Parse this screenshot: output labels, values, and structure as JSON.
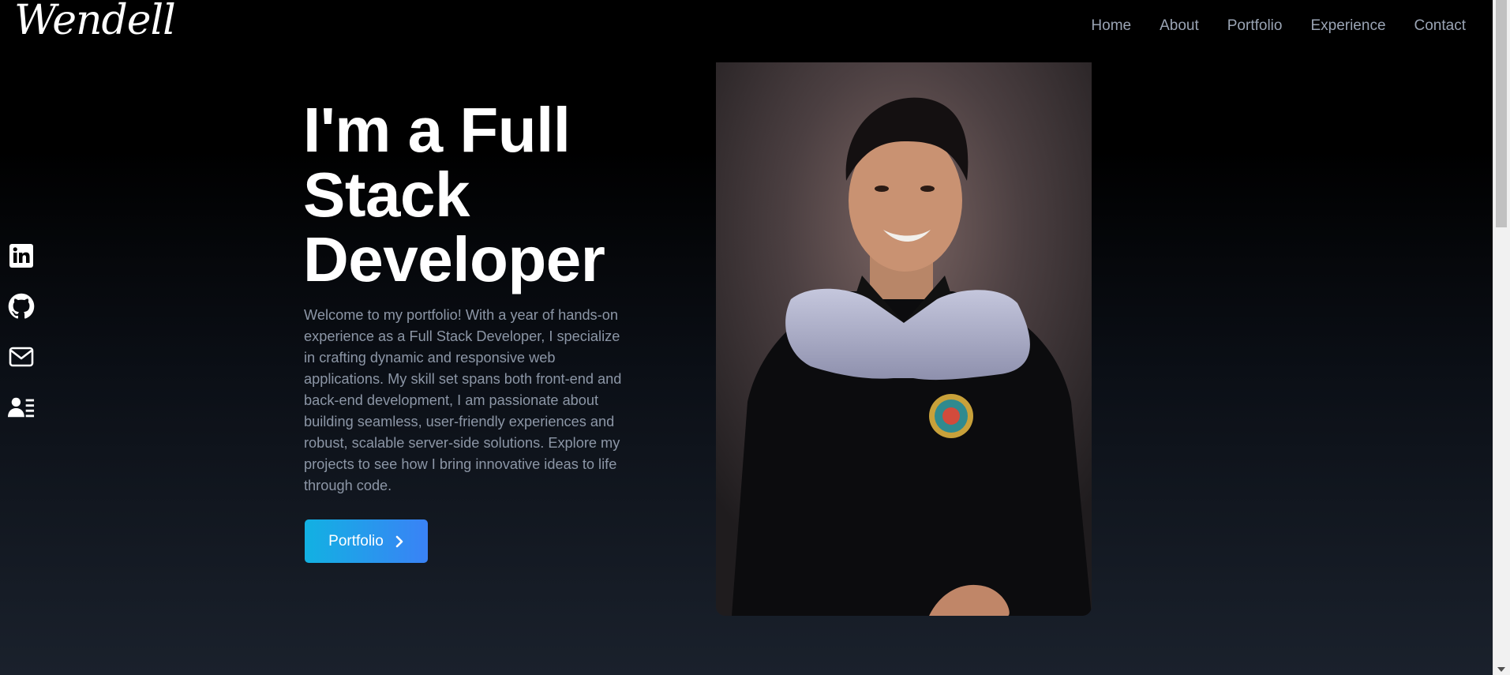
{
  "brand": {
    "name": "Wendell"
  },
  "nav": {
    "items": [
      "Home",
      "About",
      "Portfolio",
      "Experience",
      "Contact"
    ]
  },
  "socials": [
    {
      "icon": "linkedin-icon"
    },
    {
      "icon": "github-icon"
    },
    {
      "icon": "mail-icon"
    },
    {
      "icon": "resume-icon"
    }
  ],
  "hero": {
    "title": "I'm a Full Stack Developer",
    "description": "Welcome to my portfolio! With a year of hands-on experience as a Full Stack Developer, I specialize in crafting dynamic and responsive web applications. My skill set spans both front-end and back-end development, I am passionate about building seamless, user-friendly experiences and robust, scalable server-side solutions. Explore my projects to see how I bring innovative ideas to life through code.",
    "cta_label": "Portfolio"
  },
  "colors": {
    "accent_start": "#12b1e2",
    "accent_end": "#3a82f6",
    "nav_text": "#9aa4b4",
    "body_text": "#8c96a6"
  }
}
